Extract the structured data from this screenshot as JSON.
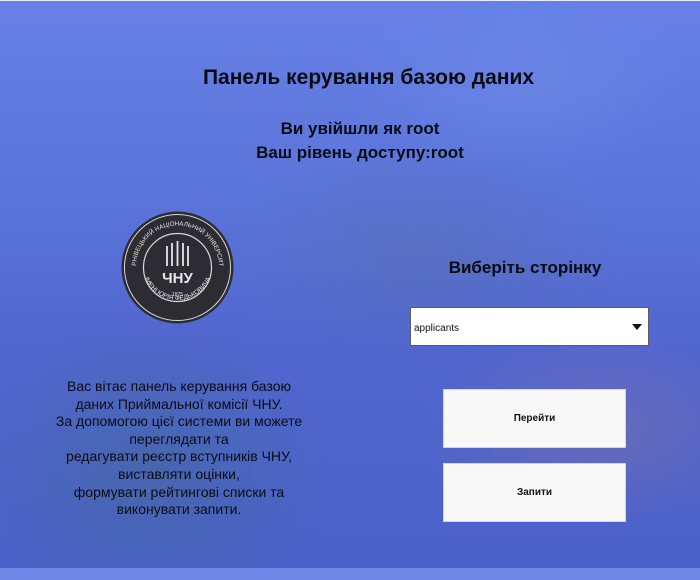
{
  "header": {
    "title": "Панель керування базою даних",
    "logged_in_as": "Ви увійшли як root",
    "access_level": "Ваш рівень доступу:root"
  },
  "logo": {
    "ring_text_top": "ЧЕРНІВЕЦЬКИЙ НАЦІОНАЛЬНИЙ УНІВЕРСИТЕТ",
    "ring_text_bottom": "ІМЕНІ ЮРІЯ ФЕДЬКОВИЧА",
    "center_text": "ЧНУ",
    "year": "1875"
  },
  "welcome": {
    "lines": [
      "Вас вітає панель керування базою",
      "даних Приймальної комісії ЧНУ.",
      "За допомогою цієї системи ви можете",
      "переглядати та",
      "редагувати реєстр вступників ЧНУ,",
      "виставляти оцінки,",
      "формувати рейтингові списки та",
      "виконувати запити."
    ]
  },
  "page_select": {
    "title": "Виберіть сторінку",
    "selected_value": "applicants"
  },
  "buttons": {
    "go": "Перейти",
    "queries": "Запити"
  },
  "colors": {
    "background": "#5a74da",
    "button_bg": "#f8f8f8",
    "text": "#0b0b14"
  }
}
